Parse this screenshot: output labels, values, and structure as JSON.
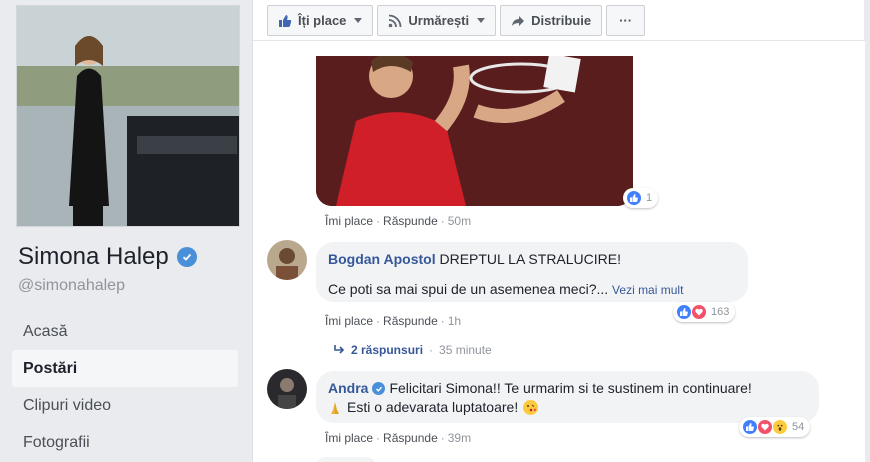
{
  "profile": {
    "name": "Simona Halep",
    "handle": "@simonahalep"
  },
  "nav": {
    "items": [
      {
        "label": "Acasă",
        "active": false
      },
      {
        "label": "Postări",
        "active": true
      },
      {
        "label": "Clipuri video",
        "active": false
      },
      {
        "label": "Fotografii",
        "active": false
      }
    ]
  },
  "actions": {
    "like": "Îți place",
    "follow": "Urmărești",
    "share": "Distribuie",
    "more": "···"
  },
  "post": {
    "reaction_count": "1",
    "like_label": "Îmi place",
    "reply_label": "Răspunde",
    "time": "50m"
  },
  "comments": [
    {
      "author": "Bogdan Apostol",
      "line1": "DREPTUL LA STRALUCIRE!",
      "line2": "Ce poti sa mai spui de un asemenea meci?...",
      "see_more": "Vezi mai mult",
      "reaction_count": "163",
      "like_label": "Îmi place",
      "reply_label": "Răspunde",
      "time": "1h",
      "replies": "2 răspunsuri",
      "replies_time": "35 minute"
    },
    {
      "author": "Andra",
      "line1": "Felicitari Simona!! Te urmarim si te sustinem in continuare!",
      "line2": "Esti o adevarata luptatoare!",
      "reaction_count": "54",
      "like_label": "Îmi place",
      "reply_label": "Răspunde",
      "time": "39m"
    }
  ],
  "icons": {
    "like": "thumbs-up-icon",
    "follow": "rss-icon",
    "share": "share-arrow-icon",
    "verified": "verified-check-icon",
    "reply_arrow": "reply-arrow-icon"
  },
  "colors": {
    "link": "#365899",
    "like_blue": "#4080ff",
    "love_red": "#f25268",
    "badge_blue": "#4a90d9"
  }
}
